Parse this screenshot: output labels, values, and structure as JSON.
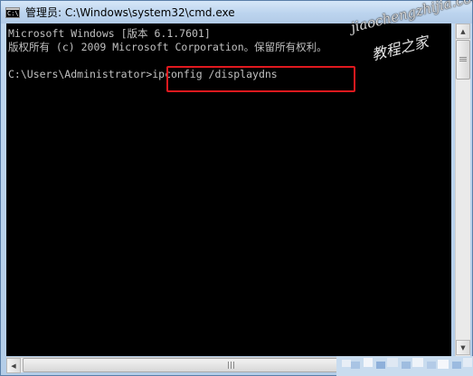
{
  "window": {
    "title": "管理员: C:\\Windows\\system32\\cmd.exe",
    "icon": "cmd-console-icon",
    "icon_glyph": "C:\\"
  },
  "console": {
    "lines": [
      "Microsoft Windows [版本 6.1.7601]",
      "版权所有 (c) 2009 Microsoft Corporation。保留所有权利。",
      "",
      "C:\\Users\\Administrator>ipconfig /displaydns"
    ],
    "text_color": "#c0c0c0",
    "background": "#000000"
  },
  "annotation": {
    "highlight_color": "#e0191e",
    "highlighted_command": "ipconfig /displaydns"
  },
  "watermark": {
    "url": "jiaochengzhijia.com",
    "name": "教程之家"
  },
  "scrollbar": {
    "up_icon": "arrow-up-icon",
    "down_icon": "arrow-down-icon",
    "left_icon": "arrow-left-icon",
    "right_icon": "arrow-right-icon"
  }
}
